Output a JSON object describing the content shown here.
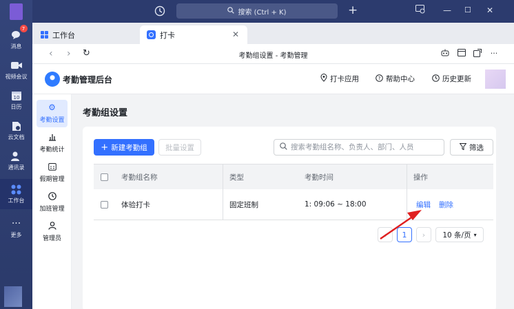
{
  "rail": {
    "items": [
      {
        "icon": "chat-bubbles-icon",
        "label": "消息",
        "badge": "7"
      },
      {
        "icon": "video-camera-icon",
        "label": "视频会议"
      },
      {
        "icon": "calendar-icon",
        "label": "日历",
        "day": "10"
      },
      {
        "icon": "cloud-doc-icon",
        "label": "云文档"
      },
      {
        "icon": "contacts-icon",
        "label": "通讯录"
      },
      {
        "icon": "workbench-icon",
        "label": "工作台"
      },
      {
        "icon": "more-dots-icon",
        "label": "更多"
      }
    ]
  },
  "titlebar": {
    "search_text": "搜索 (Ctrl + K)"
  },
  "tabs": [
    {
      "label": "工作台"
    },
    {
      "label": "打卡"
    }
  ],
  "addressbar": {
    "page_title": "考勤组设置 - 考勤管理"
  },
  "app_header": {
    "name": "考勤管理后台",
    "links": [
      "打卡应用",
      "帮助中心",
      "历史更新"
    ]
  },
  "sidemenu": {
    "items": [
      {
        "label": "考勤设置",
        "icon": "gear-icon"
      },
      {
        "label": "考勤统计",
        "icon": "bar-chart-icon"
      },
      {
        "label": "假期管理",
        "icon": "calendar-grid-icon"
      },
      {
        "label": "加班管理",
        "icon": "clock-icon"
      },
      {
        "label": "管理员",
        "icon": "person-icon"
      }
    ]
  },
  "main": {
    "title": "考勤组设置",
    "new_button": "新建考勤组",
    "batch_button": "批量设置",
    "search_placeholder": "搜索考勤组名称、负责人、部门、人员",
    "filter_button": "筛选",
    "table": {
      "headers": [
        "考勤组名称",
        "类型",
        "考勤时间",
        "操作"
      ],
      "rows": [
        {
          "name": "体验打卡",
          "type": "固定班制",
          "time": "1: 09:06 ~ 18:00",
          "edit": "编辑",
          "delete": "删除"
        }
      ]
    },
    "pagination": {
      "current": "1",
      "page_size": "10 条/页"
    }
  },
  "colors": {
    "accent": "#3370ff",
    "annotation_arrow": "#e02020"
  }
}
